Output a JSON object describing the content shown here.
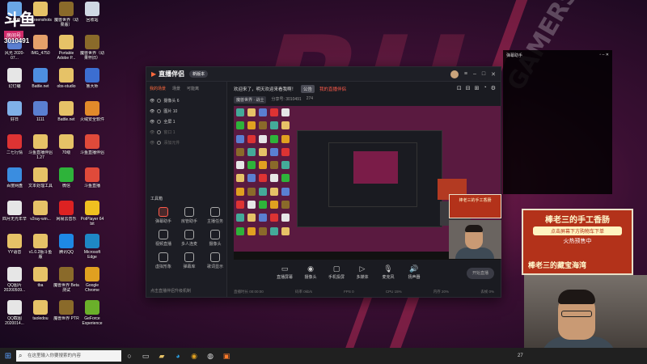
{
  "overlay": {
    "logo_text": "斗鱼",
    "room_label": "房间号",
    "room_number": "3010491"
  },
  "desktop_icons": [
    {
      "label": "此电脑",
      "color": "#6aa7e6"
    },
    {
      "label": "Screenshots",
      "color": "#e6c267"
    },
    {
      "label": "魔兽世界（幼果版）",
      "color": "#8a6a2a"
    },
    {
      "label": "回收站",
      "color": "#cfd8e3"
    },
    {
      "label": "风光 2020-07...",
      "color": "#5a7fd1"
    },
    {
      "label": "IMG_4750",
      "color": "#e4a06a"
    },
    {
      "label": "Portable Adobe P...",
      "color": "#e6c267"
    },
    {
      "label": "魔兽世界（幼果怀旧）",
      "color": "#8a6a2a"
    },
    {
      "label": "幻灯编",
      "color": "#e6e6e6"
    },
    {
      "label": "Battle.net",
      "color": "#4d8ee0"
    },
    {
      "label": "obs-studio",
      "color": "#e6c267"
    },
    {
      "label": "鲁大师",
      "color": "#3c6ed1"
    },
    {
      "label": "好日",
      "color": "#7fb0e8"
    },
    {
      "label": "1111",
      "color": "#5a7fd1"
    },
    {
      "label": "Battle.net",
      "color": "#e6c267"
    },
    {
      "label": "火绒安全软件",
      "color": "#e28a2a"
    },
    {
      "label": "二七行情",
      "color": "#d33"
    },
    {
      "label": "斗鱼直播伴侣 1.27",
      "color": "#e6c267"
    },
    {
      "label": "70级",
      "color": "#e6c267"
    },
    {
      "label": "斗鱼直播伴侣",
      "color": "#e04a3a"
    },
    {
      "label": "百度网盘",
      "color": "#3a8de0"
    },
    {
      "label": "文本处理工具",
      "color": "#e6c267"
    },
    {
      "label": "微信",
      "color": "#2eb33a"
    },
    {
      "label": "斗鱼直播",
      "color": "#e04a3a"
    },
    {
      "label": "四月无光年辛",
      "color": "#e6e6e6"
    },
    {
      "label": "v2ray-win...",
      "color": "#e6c267"
    },
    {
      "label": "网易云音乐",
      "color": "#d22"
    },
    {
      "label": "PotPlayer 64 bit",
      "color": "#f0c020"
    },
    {
      "label": "YY语音",
      "color": "#e6c267"
    },
    {
      "label": "v1.0.2版斗鱼版",
      "color": "#e6c267"
    },
    {
      "label": "腾讯QQ",
      "color": "#1e88e5"
    },
    {
      "label": "Microsoft Edge",
      "color": "#1e88c5"
    },
    {
      "label": "QQ图片 20200509...",
      "color": "#e6e6e6"
    },
    {
      "label": "tba",
      "color": "#e6c267"
    },
    {
      "label": "魔兽世界 Beta测试",
      "color": "#8a6a2a"
    },
    {
      "label": "Google Chrome",
      "color": "#e0a020"
    },
    {
      "label": "QQ截图 2020014...",
      "color": "#e6e6e6"
    },
    {
      "label": "taoledou",
      "color": "#e6c267"
    },
    {
      "label": "魔兽世界 PTR",
      "color": "#8a6a2a"
    },
    {
      "label": "GeForce Experience",
      "color": "#6ab02a"
    }
  ],
  "app": {
    "name": "直播伴侣",
    "badge": "新版本",
    "sidebar_tabs": [
      "我的场景",
      "场景",
      "可能离"
    ],
    "scenes": [
      {
        "label": "摄像头 6",
        "dim": false
      },
      {
        "label": "图片 10",
        "dim": false
      },
      {
        "label": "全屏 1",
        "dim": false
      },
      {
        "label": "窗口 1",
        "dim": true
      },
      {
        "label": "添加元件",
        "dim": true
      }
    ],
    "tools_title": "工具箱",
    "tools": [
      {
        "label": "弹幕助手",
        "red": true
      },
      {
        "label": "房管助手",
        "red": false
      },
      {
        "label": "主播任务",
        "red": false
      },
      {
        "label": "视频直播",
        "red": false
      },
      {
        "label": "多人连麦",
        "red": false
      },
      {
        "label": "摄像头",
        "red": false
      },
      {
        "label": "虚拟形象",
        "red": false
      },
      {
        "label": "弹幕库",
        "red": false
      },
      {
        "label": "歌词显示",
        "red": false
      }
    ],
    "sidebar_note": "点击直播伴侣升级机制",
    "notice_text": "欢迎来了，明天欢迎来看我啊！",
    "notice_tag": "公告",
    "notice_red": "我的直播伴侣",
    "stream_tag": "魔兽世界 · 战士",
    "stream_meta": [
      "分享号: 3010491",
      "274"
    ],
    "toolbar": [
      {
        "glyph": "▭",
        "label": "直播屏幕"
      },
      {
        "glyph": "◉",
        "label": "摄像头"
      },
      {
        "glyph": "▢",
        "label": "手机投屏"
      },
      {
        "glyph": "▷",
        "label": "多媒体"
      },
      {
        "glyph": "🎙",
        "label": "麦克风"
      },
      {
        "glyph": "🔊",
        "label": "扬声器"
      }
    ],
    "go_live": "开始直播",
    "status": [
      "直播时长 00:00:00",
      "码率 0kb/s",
      "FPS 0",
      "CPU 15%",
      "内存 20%",
      "丢帧 0%"
    ]
  },
  "side_panel": {
    "title": "弹幕助手"
  },
  "ad_big": {
    "title": "棒老三的手工香肠",
    "sub": "点击屏幕下方购物车下单",
    "hot": "火热预售中",
    "foot": "棒老三的藏宝海湾"
  },
  "ad_small": {
    "title": "棒老三的手工香肠"
  },
  "taskbar": {
    "search_placeholder": "在这里输入你要搜索的内容",
    "temp": "27"
  }
}
